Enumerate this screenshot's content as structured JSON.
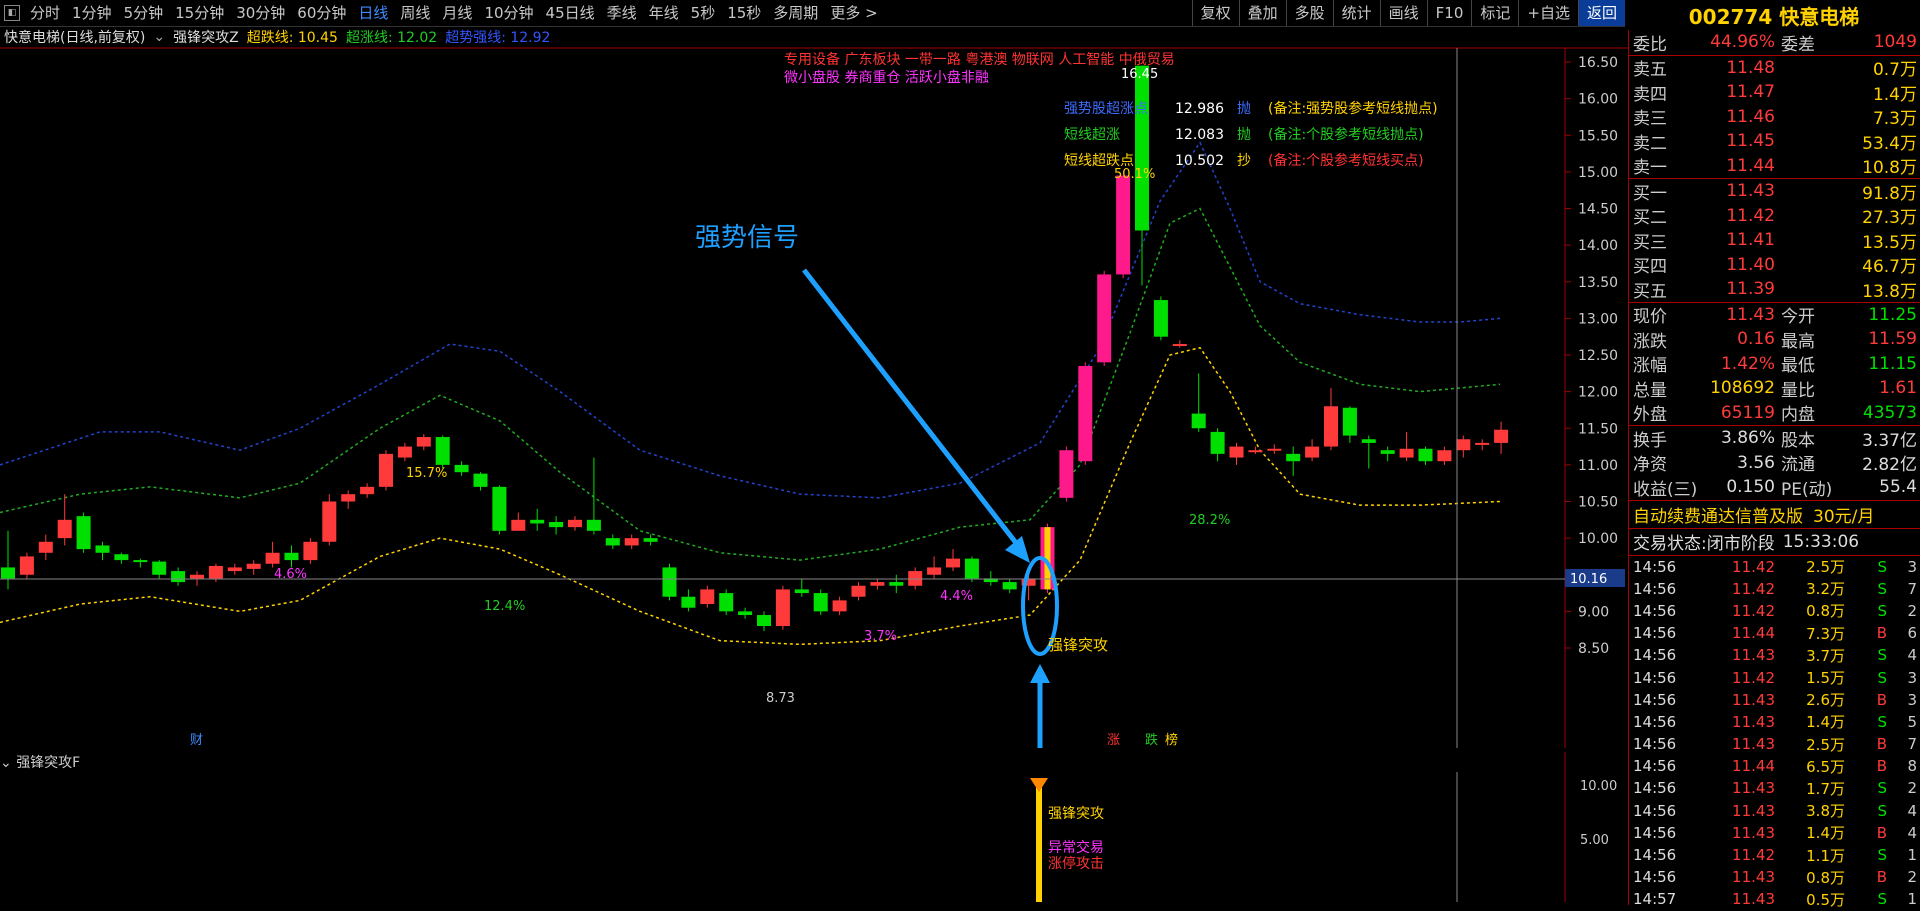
{
  "toolbar": {
    "periods": [
      "分时",
      "1分钟",
      "5分钟",
      "15分钟",
      "30分钟",
      "60分钟",
      "日线",
      "周线",
      "月线",
      "10分钟",
      "45日线",
      "季线",
      "年线",
      "5秒",
      "15秒",
      "多周期",
      "更多 >"
    ],
    "active": "日线",
    "right_buttons": [
      "复权",
      "叠加",
      "多股",
      "统计",
      "画线",
      "F10",
      "标记",
      "+自选",
      "返回"
    ]
  },
  "stock": {
    "code_name": "002774 快意电梯"
  },
  "chart_header": {
    "title": "快意电梯(日线,前复权)",
    "indicator": "强锋突攻Z",
    "line1": "超跌线: 10.45",
    "line2": "超涨线: 12.02",
    "line3": "超势强线: 12.92"
  },
  "chart_text": {
    "concepts_line1": "专用设备   广东板块   一带一路 粤港澳 物联网 人工智能 中俄贸易",
    "concepts_line2": "微小盘股 券商重仓 活跃小盘非融",
    "strong_signal": "强势信号",
    "peak_label": "16.45",
    "low_label": "8.73",
    "pct_labels": [
      "15.7%",
      "4.6%",
      "12.4%",
      "3.7%",
      "4.4%",
      "50.1%",
      "28.2%"
    ],
    "signal_label": "强锋突攻",
    "bottom_marks": [
      "财",
      "涨",
      "跌",
      "榜"
    ],
    "crosshair_price": "10.16"
  },
  "legend": [
    {
      "name": "强势股超涨点",
      "value": "12.986",
      "tag": "抛",
      "note": "(备注:强势股参考短线抛点)",
      "color": "#3c6cff"
    },
    {
      "name": "短线超涨",
      "value": "12.083",
      "tag": "抛",
      "note": "(备注:个股参考短线抛点)",
      "color": "#22cc22"
    },
    {
      "name": "短线超跌点",
      "value": "10.502",
      "tag": "抄",
      "note": "(备注:个股参考短线买点)",
      "color": "#ffd200"
    }
  ],
  "y_axis": [
    "16.50",
    "16.00",
    "15.50",
    "15.00",
    "14.50",
    "14.00",
    "13.50",
    "13.00",
    "12.50",
    "12.00",
    "11.50",
    "11.00",
    "10.50",
    "10.00",
    "9.50",
    "9.00",
    "8.50"
  ],
  "sub_chart": {
    "title": "强锋突攻F",
    "y_axis": [
      "10.00",
      "5.00"
    ],
    "labels": [
      "强锋突攻",
      "异常交易",
      "涨停攻击"
    ]
  },
  "order_book": {
    "ratio": {
      "label": "委比",
      "value": "44.96%",
      "label2": "委差",
      "value2": "1049"
    },
    "asks": [
      {
        "label": "卖五",
        "price": "11.48",
        "vol": "0.7万"
      },
      {
        "label": "卖四",
        "price": "11.47",
        "vol": "1.4万"
      },
      {
        "label": "卖三",
        "price": "11.46",
        "vol": "7.3万"
      },
      {
        "label": "卖二",
        "price": "11.45",
        "vol": "53.4万"
      },
      {
        "label": "卖一",
        "price": "11.44",
        "vol": "10.8万"
      }
    ],
    "bids": [
      {
        "label": "买一",
        "price": "11.43",
        "vol": "91.8万"
      },
      {
        "label": "买二",
        "price": "11.42",
        "vol": "27.3万"
      },
      {
        "label": "买三",
        "price": "11.41",
        "vol": "13.5万"
      },
      {
        "label": "买四",
        "price": "11.40",
        "vol": "46.7万"
      },
      {
        "label": "买五",
        "price": "11.39",
        "vol": "13.8万"
      }
    ]
  },
  "quote": [
    {
      "k": "现价",
      "v": "11.43",
      "vc": "red",
      "k2": "今开",
      "v2": "11.25",
      "v2c": "green"
    },
    {
      "k": "涨跌",
      "v": "0.16",
      "vc": "red",
      "k2": "最高",
      "v2": "11.59",
      "v2c": "red"
    },
    {
      "k": "涨幅",
      "v": "1.42%",
      "vc": "red",
      "k2": "最低",
      "v2": "11.15",
      "v2c": "green"
    },
    {
      "k": "总量",
      "v": "108692",
      "vc": "yellow",
      "k2": "量比",
      "v2": "1.61",
      "v2c": "red"
    },
    {
      "k": "外盘",
      "v": "65119",
      "vc": "red",
      "k2": "内盘",
      "v2": "43573",
      "v2c": "green"
    }
  ],
  "fundamentals": [
    {
      "k": "换手",
      "v": "3.86%",
      "k2": "股本",
      "v2": "3.37亿"
    },
    {
      "k": "净资",
      "v": "3.56",
      "k2": "流通",
      "v2": "2.82亿"
    },
    {
      "k": "收益(三)",
      "v": "0.150",
      "k2": "PE(动)",
      "v2": "55.4"
    }
  ],
  "ad": {
    "text": "自动续费通达信普及版",
    "price": "30元/月"
  },
  "status": {
    "label": "交易状态:",
    "value": "闭市阶段",
    "time": "15:33:06"
  },
  "ticks": [
    {
      "t": "14:56",
      "p": "11.42",
      "v": "2.5万",
      "s": "S",
      "n": "3"
    },
    {
      "t": "14:56",
      "p": "11.42",
      "v": "3.2万",
      "s": "S",
      "n": "7"
    },
    {
      "t": "14:56",
      "p": "11.42",
      "v": "0.8万",
      "s": "S",
      "n": "2"
    },
    {
      "t": "14:56",
      "p": "11.44",
      "v": "7.3万",
      "s": "B",
      "n": "6"
    },
    {
      "t": "14:56",
      "p": "11.43",
      "v": "3.7万",
      "s": "S",
      "n": "4"
    },
    {
      "t": "14:56",
      "p": "11.42",
      "v": "1.5万",
      "s": "S",
      "n": "3"
    },
    {
      "t": "14:56",
      "p": "11.43",
      "v": "2.6万",
      "s": "B",
      "n": "3"
    },
    {
      "t": "14:56",
      "p": "11.43",
      "v": "1.4万",
      "s": "S",
      "n": "5"
    },
    {
      "t": "14:56",
      "p": "11.43",
      "v": "2.5万",
      "s": "B",
      "n": "7"
    },
    {
      "t": "14:56",
      "p": "11.44",
      "v": "6.5万",
      "s": "B",
      "n": "8"
    },
    {
      "t": "14:56",
      "p": "11.43",
      "v": "1.7万",
      "s": "S",
      "n": "2"
    },
    {
      "t": "14:56",
      "p": "11.43",
      "v": "3.8万",
      "s": "S",
      "n": "4"
    },
    {
      "t": "14:56",
      "p": "11.43",
      "v": "1.4万",
      "s": "B",
      "n": "4"
    },
    {
      "t": "14:56",
      "p": "11.42",
      "v": "1.1万",
      "s": "S",
      "n": "1"
    },
    {
      "t": "14:56",
      "p": "11.43",
      "v": "0.8万",
      "s": "B",
      "n": "2"
    },
    {
      "t": "14:57",
      "p": "11.43",
      "v": "0.5万",
      "s": "S",
      "n": "1"
    }
  ],
  "colors": {
    "up": "#ff3a3a",
    "down": "#00e000",
    "limit_up": "#ff1a8c",
    "axis": "#a00000",
    "blue_band": "#2244cc",
    "green_band": "#22aa22",
    "yellow_band": "#ffd200",
    "annot": "#1ea0ff"
  }
}
